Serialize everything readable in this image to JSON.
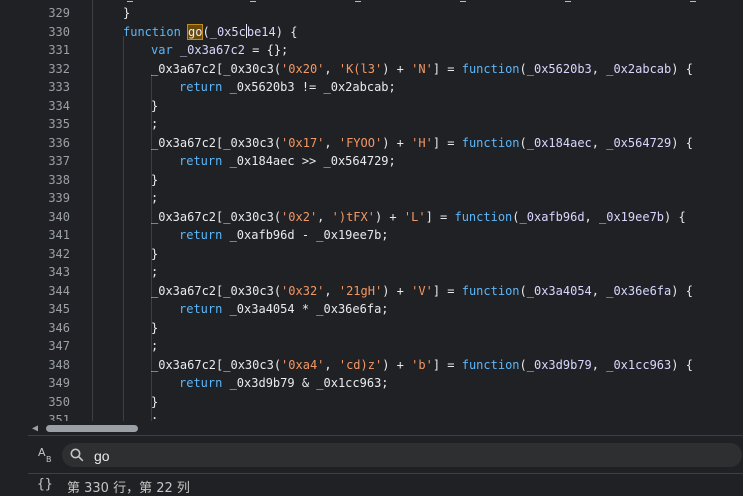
{
  "editor": {
    "line_numbers": [
      "329",
      "330",
      "331",
      "332",
      "333",
      "334",
      "335",
      "336",
      "337",
      "338",
      "339",
      "340",
      "341",
      "342",
      "343",
      "344",
      "345",
      "346",
      "347",
      "348",
      "349",
      "350",
      "351"
    ],
    "lines": [
      {
        "indent": 0,
        "tokens": [
          {
            "t": "}",
            "c": ""
          }
        ]
      },
      {
        "indent": 0,
        "tokens": [
          {
            "t": "function ",
            "c": "kw"
          },
          {
            "t": "go",
            "c": "hl"
          },
          {
            "t": "(",
            "c": ""
          },
          {
            "t": "_0x5c",
            "c": "var"
          },
          {
            "t": "|",
            "c": "cursor"
          },
          {
            "t": "be14",
            "c": "var"
          },
          {
            "t": ") {",
            "c": ""
          }
        ]
      },
      {
        "indent": 1,
        "tokens": [
          {
            "t": "var ",
            "c": "kw"
          },
          {
            "t": "_0x3a67c2",
            "c": "var"
          },
          {
            "t": " = {};",
            "c": ""
          }
        ]
      },
      {
        "indent": 1,
        "tokens": [
          {
            "t": "_0x3a67c2[_0x30c3(",
            "c": ""
          },
          {
            "t": "'0x20'",
            "c": "str"
          },
          {
            "t": ", ",
            "c": ""
          },
          {
            "t": "'K(l3'",
            "c": "str"
          },
          {
            "t": ") + ",
            "c": ""
          },
          {
            "t": "'N'",
            "c": "str"
          },
          {
            "t": "] = ",
            "c": ""
          },
          {
            "t": "function",
            "c": "kw"
          },
          {
            "t": "(",
            "c": ""
          },
          {
            "t": "_0x5620b3",
            "c": "var"
          },
          {
            "t": ", ",
            "c": ""
          },
          {
            "t": "_0x2abcab",
            "c": "var"
          },
          {
            "t": ") {",
            "c": ""
          }
        ]
      },
      {
        "indent": 2,
        "tokens": [
          {
            "t": "return ",
            "c": "kw"
          },
          {
            "t": "_0x5620b3 != _0x2abcab;",
            "c": ""
          }
        ]
      },
      {
        "indent": 1,
        "tokens": [
          {
            "t": "}",
            "c": ""
          }
        ]
      },
      {
        "indent": 1,
        "tokens": [
          {
            "t": ";",
            "c": ""
          }
        ]
      },
      {
        "indent": 1,
        "tokens": [
          {
            "t": "_0x3a67c2[_0x30c3(",
            "c": ""
          },
          {
            "t": "'0x17'",
            "c": "str"
          },
          {
            "t": ", ",
            "c": ""
          },
          {
            "t": "'FYOO'",
            "c": "str"
          },
          {
            "t": ") + ",
            "c": ""
          },
          {
            "t": "'H'",
            "c": "str"
          },
          {
            "t": "] = ",
            "c": ""
          },
          {
            "t": "function",
            "c": "kw"
          },
          {
            "t": "(",
            "c": ""
          },
          {
            "t": "_0x184aec",
            "c": "var"
          },
          {
            "t": ", ",
            "c": ""
          },
          {
            "t": "_0x564729",
            "c": "var"
          },
          {
            "t": ") {",
            "c": ""
          }
        ]
      },
      {
        "indent": 2,
        "tokens": [
          {
            "t": "return ",
            "c": "kw"
          },
          {
            "t": "_0x184aec >> _0x564729;",
            "c": ""
          }
        ]
      },
      {
        "indent": 1,
        "tokens": [
          {
            "t": "}",
            "c": ""
          }
        ]
      },
      {
        "indent": 1,
        "tokens": [
          {
            "t": ";",
            "c": ""
          }
        ]
      },
      {
        "indent": 1,
        "tokens": [
          {
            "t": "_0x3a67c2[_0x30c3(",
            "c": ""
          },
          {
            "t": "'0x2'",
            "c": "str"
          },
          {
            "t": ", ",
            "c": ""
          },
          {
            "t": "')tFX'",
            "c": "str"
          },
          {
            "t": ") + ",
            "c": ""
          },
          {
            "t": "'L'",
            "c": "str"
          },
          {
            "t": "] = ",
            "c": ""
          },
          {
            "t": "function",
            "c": "kw"
          },
          {
            "t": "(",
            "c": ""
          },
          {
            "t": "_0xafb96d",
            "c": "var"
          },
          {
            "t": ", ",
            "c": ""
          },
          {
            "t": "_0x19ee7b",
            "c": "var"
          },
          {
            "t": ") {",
            "c": ""
          }
        ]
      },
      {
        "indent": 2,
        "tokens": [
          {
            "t": "return ",
            "c": "kw"
          },
          {
            "t": "_0xafb96d - _0x19ee7b;",
            "c": ""
          }
        ]
      },
      {
        "indent": 1,
        "tokens": [
          {
            "t": "}",
            "c": ""
          }
        ]
      },
      {
        "indent": 1,
        "tokens": [
          {
            "t": ";",
            "c": ""
          }
        ]
      },
      {
        "indent": 1,
        "tokens": [
          {
            "t": "_0x3a67c2[_0x30c3(",
            "c": ""
          },
          {
            "t": "'0x32'",
            "c": "str"
          },
          {
            "t": ", ",
            "c": ""
          },
          {
            "t": "'21gH'",
            "c": "str"
          },
          {
            "t": ") + ",
            "c": ""
          },
          {
            "t": "'V'",
            "c": "str"
          },
          {
            "t": "] = ",
            "c": ""
          },
          {
            "t": "function",
            "c": "kw"
          },
          {
            "t": "(",
            "c": ""
          },
          {
            "t": "_0x3a4054",
            "c": "var"
          },
          {
            "t": ", ",
            "c": ""
          },
          {
            "t": "_0x36e6fa",
            "c": "var"
          },
          {
            "t": ") {",
            "c": ""
          }
        ]
      },
      {
        "indent": 2,
        "tokens": [
          {
            "t": "return ",
            "c": "kw"
          },
          {
            "t": "_0x3a4054 * _0x36e6fa;",
            "c": ""
          }
        ]
      },
      {
        "indent": 1,
        "tokens": [
          {
            "t": "}",
            "c": ""
          }
        ]
      },
      {
        "indent": 1,
        "tokens": [
          {
            "t": ";",
            "c": ""
          }
        ]
      },
      {
        "indent": 1,
        "tokens": [
          {
            "t": "_0x3a67c2[_0x30c3(",
            "c": ""
          },
          {
            "t": "'0xa4'",
            "c": "str"
          },
          {
            "t": ", ",
            "c": ""
          },
          {
            "t": "'cd)z'",
            "c": "str"
          },
          {
            "t": ") + ",
            "c": ""
          },
          {
            "t": "'b'",
            "c": "str"
          },
          {
            "t": "] = ",
            "c": ""
          },
          {
            "t": "function",
            "c": "kw"
          },
          {
            "t": "(",
            "c": ""
          },
          {
            "t": "_0x3d9b79",
            "c": "var"
          },
          {
            "t": ", ",
            "c": ""
          },
          {
            "t": "_0x1cc963",
            "c": "var"
          },
          {
            "t": ") {",
            "c": ""
          }
        ]
      },
      {
        "indent": 2,
        "tokens": [
          {
            "t": "return ",
            "c": "kw"
          },
          {
            "t": "_0x3d9b79 & _0x1cc963;",
            "c": ""
          }
        ]
      },
      {
        "indent": 1,
        "tokens": [
          {
            "t": "}",
            "c": ""
          }
        ]
      },
      {
        "indent": 1,
        "tokens": [
          {
            "t": ";",
            "c": ""
          }
        ]
      }
    ]
  },
  "scrollbar": {
    "left_arrow_icon": "triangle-left-icon"
  },
  "search": {
    "case_icon_a": "A",
    "case_icon_b": "B",
    "icon": "search-icon",
    "value": "go"
  },
  "status": {
    "braces_icon": "{}",
    "position_text": "第 330 行，第 22 列"
  },
  "colors": {
    "background": "#202124",
    "keyword": "#5cb6f8",
    "string": "#f29766",
    "variable": "#d7d7ff",
    "highlight": "#6b4a0e"
  }
}
